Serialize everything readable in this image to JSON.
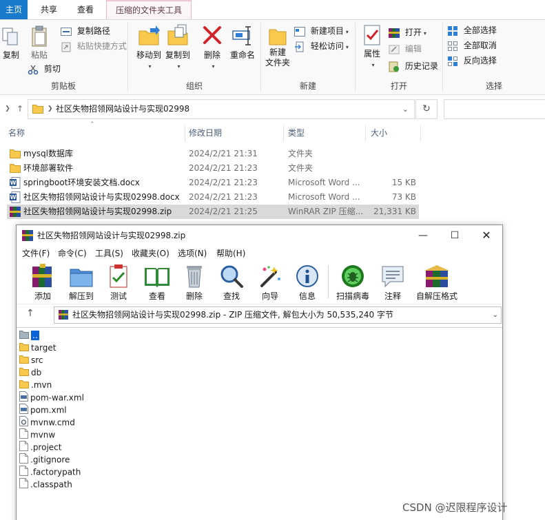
{
  "explorer": {
    "tabs": [
      "主页",
      "共享",
      "查看",
      "压缩的文件夹工具"
    ],
    "ribbon": {
      "clipboard": {
        "label": "剪贴板",
        "copy": "复制",
        "paste": "粘贴",
        "copy_path": "复制路径",
        "paste_shortcut": "粘贴快捷方式",
        "cut": "剪切"
      },
      "organize": {
        "label": "组织",
        "move_to": "移动到",
        "copy_to": "复制到",
        "delete": "删除",
        "rename": "重命名"
      },
      "new": {
        "label": "新建",
        "new_folder": "新建\n文件夹",
        "new_item": "新建项目",
        "easy_access": "轻松访问"
      },
      "open": {
        "label": "打开",
        "properties": "属性",
        "open": "打开",
        "edit": "编辑",
        "history": "历史记录"
      },
      "select": {
        "label": "选择",
        "select_all": "全部选择",
        "select_none": "全部取消",
        "invert": "反向选择"
      }
    },
    "address": "社区失物招领网站设计与实现02998",
    "columns": {
      "name": "名称",
      "modified": "修改日期",
      "type": "类型",
      "size": "大小"
    },
    "files": [
      {
        "name": "mysql数据库",
        "date": "2024/2/21 21:31",
        "type": "文件夹",
        "size": "",
        "icon": "folder-icon"
      },
      {
        "name": "环境部署软件",
        "date": "2024/2/21 21:23",
        "type": "文件夹",
        "size": "",
        "icon": "folder-icon"
      },
      {
        "name": "springboot环境安装文档.docx",
        "date": "2024/2/21 21:23",
        "type": "Microsoft Word ...",
        "size": "15 KB",
        "icon": "word-icon"
      },
      {
        "name": "社区失物招领网站设计与实现02998.docx",
        "date": "2024/2/21 21:23",
        "type": "Microsoft Word ...",
        "size": "73 KB",
        "icon": "word-icon"
      },
      {
        "name": "社区失物招领网站设计与实现02998.zip",
        "date": "2024/2/21 21:25",
        "type": "WinRAR ZIP 压缩...",
        "size": "21,331 KB",
        "icon": "winrar-icon"
      }
    ]
  },
  "winrar": {
    "title": "社区失物招领网站设计与实现02998.zip",
    "menu": [
      "文件(F)",
      "命令(C)",
      "工具(S)",
      "收藏夹(O)",
      "选项(N)",
      "帮助(H)"
    ],
    "toolbar": [
      "添加",
      "解压到",
      "测试",
      "查看",
      "删除",
      "查找",
      "向导",
      "信息",
      "扫描病毒",
      "注释",
      "自解压格式"
    ],
    "path": "社区失物招领网站设计与实现02998.zip - ZIP 压缩文件, 解包大小为 50,535,240 字节",
    "items": [
      {
        "name": "..",
        "icon": "parent-folder-icon"
      },
      {
        "name": "target",
        "icon": "folder-icon"
      },
      {
        "name": "src",
        "icon": "folder-icon"
      },
      {
        "name": "db",
        "icon": "folder-icon"
      },
      {
        "name": ".mvn",
        "icon": "folder-icon"
      },
      {
        "name": "pom-war.xml",
        "icon": "xml-file-icon"
      },
      {
        "name": "pom.xml",
        "icon": "xml-file-icon"
      },
      {
        "name": "mvnw.cmd",
        "icon": "cmd-file-icon"
      },
      {
        "name": "mvnw",
        "icon": "file-icon"
      },
      {
        "name": ".project",
        "icon": "file-icon"
      },
      {
        "name": ".gitignore",
        "icon": "file-icon"
      },
      {
        "name": ".factorypath",
        "icon": "file-icon"
      },
      {
        "name": ".classpath",
        "icon": "file-icon"
      }
    ]
  },
  "watermark": "CSDN @迟限程序设计",
  "colors": {
    "accent": "#1979ca",
    "folder": "#f8c94c",
    "selection": "#0a64d8"
  }
}
